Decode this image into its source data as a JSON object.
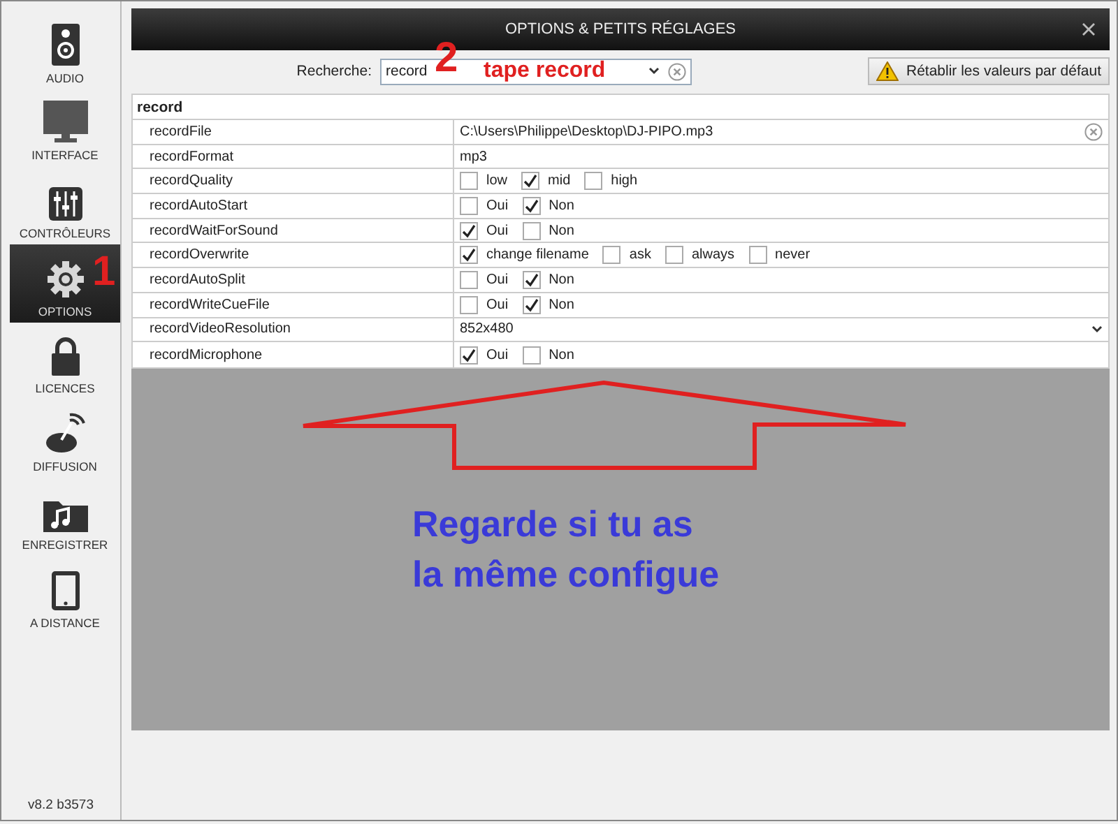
{
  "sidebar": {
    "items": [
      {
        "kind": "speaker",
        "label": "AUDIO",
        "selected": false
      },
      {
        "kind": "monitor",
        "label": "INTERFACE",
        "selected": false
      },
      {
        "kind": "sliders",
        "label": "CONTRÔLEURS",
        "selected": false
      },
      {
        "kind": "gear",
        "label": "OPTIONS",
        "selected": true
      },
      {
        "kind": "lock",
        "label": "LICENCES",
        "selected": false
      },
      {
        "kind": "dish",
        "label": "DIFFUSION",
        "selected": false
      },
      {
        "kind": "folder",
        "label": "ENREGISTRER",
        "selected": false
      },
      {
        "kind": "tablet",
        "label": "A DISTANCE",
        "selected": false
      }
    ],
    "version": "v8.2 b3573"
  },
  "window": {
    "title": "OPTIONS & PETITS RÉGLAGES"
  },
  "search": {
    "label": "Recherche:",
    "value": "record"
  },
  "reset_button": "Rétablir les valeurs par défaut",
  "table": {
    "group": "record",
    "rows": [
      {
        "name": "recordFile",
        "kind": "file",
        "value": "C:\\Users\\Philippe\\Desktop\\DJ-PIPO.mp3"
      },
      {
        "name": "recordFormat",
        "kind": "text",
        "value": "mp3"
      },
      {
        "name": "recordQuality",
        "kind": "choices",
        "options": [
          {
            "label": "low",
            "checked": false
          },
          {
            "label": "mid",
            "checked": true
          },
          {
            "label": "high",
            "checked": false
          }
        ]
      },
      {
        "name": "recordAutoStart",
        "kind": "choices",
        "options": [
          {
            "label": "Oui",
            "checked": false
          },
          {
            "label": "Non",
            "checked": true
          }
        ]
      },
      {
        "name": "recordWaitForSound",
        "kind": "choices",
        "options": [
          {
            "label": "Oui",
            "checked": true
          },
          {
            "label": "Non",
            "checked": false
          }
        ]
      },
      {
        "name": "recordOverwrite",
        "kind": "choices",
        "options": [
          {
            "label": "change filename",
            "checked": true
          },
          {
            "label": "ask",
            "checked": false
          },
          {
            "label": "always",
            "checked": false
          },
          {
            "label": "never",
            "checked": false
          }
        ]
      },
      {
        "name": "recordAutoSplit",
        "kind": "choices",
        "options": [
          {
            "label": "Oui",
            "checked": false
          },
          {
            "label": "Non",
            "checked": true
          }
        ]
      },
      {
        "name": "recordWriteCueFile",
        "kind": "choices",
        "options": [
          {
            "label": "Oui",
            "checked": false
          },
          {
            "label": "Non",
            "checked": true
          }
        ]
      },
      {
        "name": "recordVideoResolution",
        "kind": "select",
        "value": "852x480"
      },
      {
        "name": "recordMicrophone",
        "kind": "choices",
        "options": [
          {
            "label": "Oui",
            "checked": true
          },
          {
            "label": "Non",
            "checked": false
          }
        ]
      }
    ]
  },
  "annotations": {
    "step_1": "1",
    "step_2": "2",
    "search_hint": "tape record",
    "note": [
      "Regarde si tu as",
      "la même configue"
    ]
  }
}
